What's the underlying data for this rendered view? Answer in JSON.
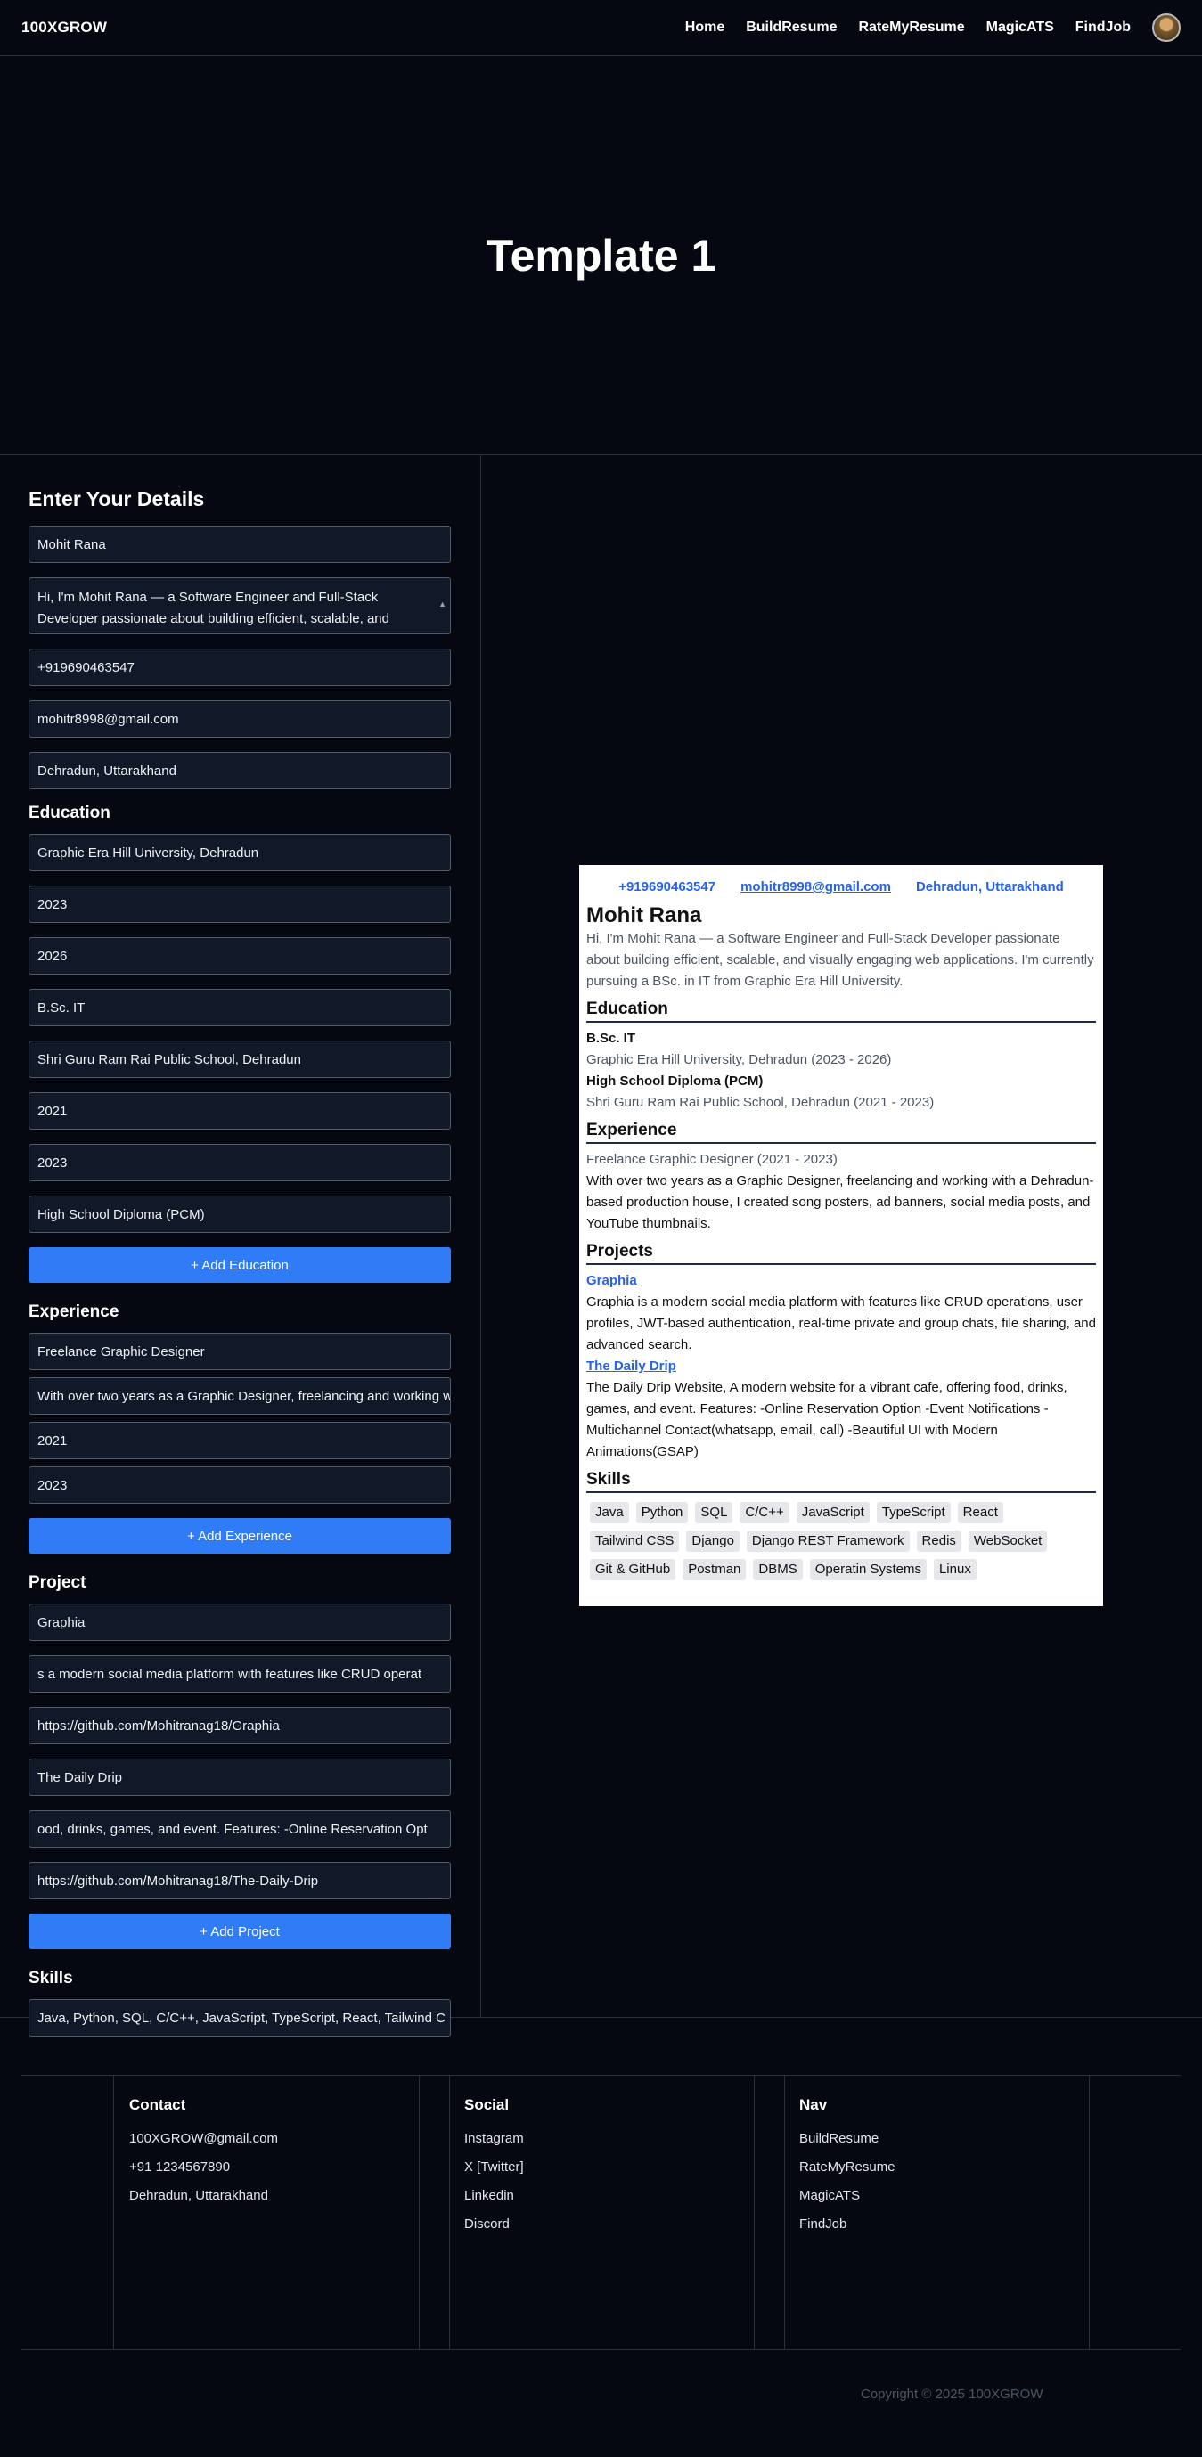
{
  "nav": {
    "brand": "100XGROW",
    "links": [
      "Home",
      "BuildResume",
      "RateMyResume",
      "MagicATS",
      "FindJob"
    ]
  },
  "hero": {
    "title": "Template 1"
  },
  "form": {
    "title": "Enter Your Details",
    "name": "Mohit Rana",
    "summary": "Hi, I'm Mohit Rana — a Software Engineer and Full-Stack Developer passionate about building efficient, scalable, and visually engaging web applications.",
    "phone": "+919690463547",
    "email": "mohitr8998@gmail.com",
    "location": "Dehradun, Uttarakhand",
    "education_title": "Education",
    "education": [
      {
        "institution": "Graphic Era Hill University, Dehradun",
        "start": "2023",
        "end": "2026",
        "degree": "B.Sc. IT"
      },
      {
        "institution": "Shri Guru Ram Rai Public School, Dehradun",
        "start": "2021",
        "end": "2023",
        "degree": "High School Diploma (PCM)"
      }
    ],
    "add_education": "+ Add Education",
    "experience_title": "Experience",
    "experience": [
      {
        "role": "Freelance Graphic Designer",
        "description": "With over two years as a Graphic Designer, freelancing and working with",
        "start": "2021",
        "end": "2023"
      }
    ],
    "add_experience": "+ Add Experience",
    "project_title": "Project",
    "projects": [
      {
        "name": "Graphia",
        "description": "s a modern social media platform with features like CRUD operat",
        "link": "https://github.com/Mohitranag18/Graphia"
      },
      {
        "name": "The Daily Drip",
        "description": "ood, drinks, games, and event. Features: -Online Reservation Opt",
        "link": "https://github.com/Mohitranag18/The-Daily-Drip"
      }
    ],
    "add_project": "+ Add Project",
    "skills_title": "Skills",
    "skills_value": "Java, Python, SQL, C/C++, JavaScript, TypeScript, React, Tailwind C"
  },
  "resume": {
    "phone": "+919690463547",
    "email": "mohitr8998@gmail.com",
    "location": "Dehradun, Uttarakhand",
    "name": "Mohit Rana",
    "summary": "Hi, I'm Mohit Rana — a Software Engineer and Full-Stack Developer passionate about building efficient, scalable, and visually engaging web applications. I'm currently pursuing a BSc. in IT from Graphic Era Hill University.",
    "education_heading": "Education",
    "education": [
      {
        "degree": "B.Sc. IT",
        "detail": "Graphic Era Hill University, Dehradun (2023 - 2026)"
      },
      {
        "degree": "High School Diploma (PCM)",
        "detail": "Shri Guru Ram Rai Public School, Dehradun (2021 - 2023)"
      }
    ],
    "experience_heading": "Experience",
    "experience": [
      {
        "title": "Freelance Graphic Designer (2021 - 2023)",
        "description": "With over two years as a Graphic Designer, freelancing and working with a Dehradun-based production house, I created song posters, ad banners, social media posts, and YouTube thumbnails."
      }
    ],
    "projects_heading": "Projects",
    "projects": [
      {
        "name": "Graphia",
        "description": "Graphia is a modern social media platform with features like CRUD operations, user profiles, JWT-based authentication, real-time private and group chats, file sharing, and advanced search."
      },
      {
        "name": "The Daily Drip",
        "description": "The Daily Drip Website, A modern website for a vibrant cafe, offering food, drinks, games, and event. Features: -Online Reservation Option -Event Notifications -Multichannel Contact(whatsapp, email, call) -Beautiful UI with Modern Animations(GSAP)"
      }
    ],
    "skills_heading": "Skills",
    "skills": [
      "Java",
      "Python",
      "SQL",
      "C/C++",
      "JavaScript",
      "TypeScript",
      "React",
      "Tailwind CSS",
      "Django",
      "Django REST Framework",
      "Redis",
      "WebSocket",
      "Git & GitHub",
      "Postman",
      "DBMS",
      "Operatin Systems",
      "Linux"
    ]
  },
  "footer": {
    "contact_title": "Contact",
    "contact": [
      "100XGROW@gmail.com",
      "+91 1234567890",
      "Dehradun, Uttarakhand"
    ],
    "social_title": "Social",
    "social": [
      "Instagram",
      "X [Twitter]",
      "Linkedin",
      "Discord"
    ],
    "nav_title": "Nav",
    "nav": [
      "BuildResume",
      "RateMyResume",
      "MagicATS",
      "FindJob"
    ],
    "copyright": "Copyright © 2025 100XGROW"
  },
  "colors": {
    "background": "#050811",
    "accent": "#2f7cf6",
    "link": "#2563eb"
  }
}
